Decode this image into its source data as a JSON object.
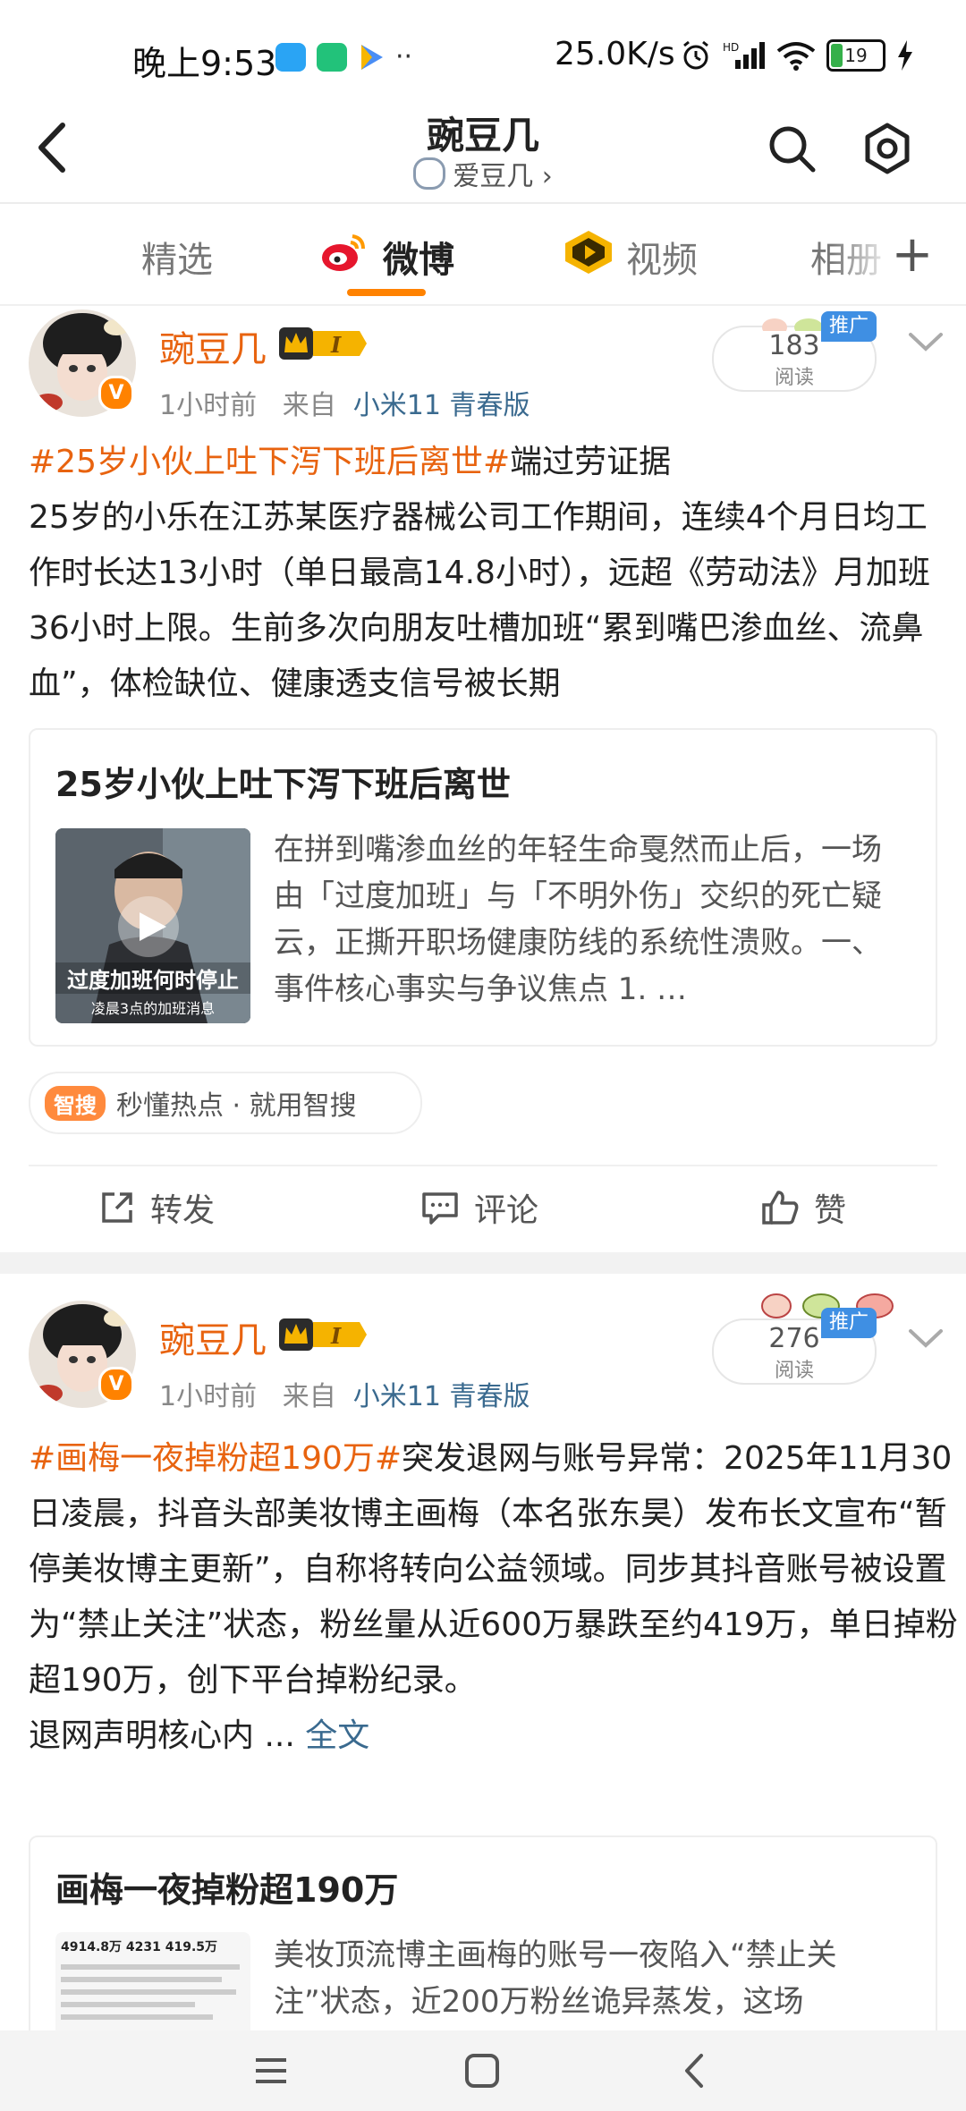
{
  "status_bar": {
    "time": "晚上9:53",
    "more": "··",
    "speed": "25.0K/s",
    "battery": "19"
  },
  "header": {
    "title": "豌豆几",
    "subtitle": "爱豆几 ›"
  },
  "tabs": [
    {
      "label": "精选"
    },
    {
      "label": "微博"
    },
    {
      "label": "视频"
    },
    {
      "label": "相册"
    }
  ],
  "tab_plus": "+",
  "posts": [
    {
      "username": "豌豆几",
      "level": "I",
      "time": "1小时前",
      "from_label": "来自",
      "source": "小米11 青春版",
      "reads": "183",
      "reads_label": "阅读",
      "promo": "推广",
      "hashtag": "#25岁小伙上吐下泻下班后离世#",
      "text_after_tag": "端过劳证据",
      "text": "25岁的小乐在江苏某医疗器械公司工作期间，连续4个月日均工作时长达13小时（单日最高14.8小时），远超《劳动法》月加班36小时上限。生前多次向朋友吐槽加班“累到嘴巴渗血丝、流鼻血”，体检缺位、健康透支信号被长期",
      "card": {
        "title": "25岁小伙上吐下泻下班后离世",
        "thumb_caption": "过度加班何时停止",
        "thumb_sub": "凌晨3点的加班消息",
        "summary": "在拼到嘴渗血丝的年轻生命戛然而止后，一场由「过度加班」与「不明外伤」交织的死亡疑云，正撕开职场健康防线的系统性溃败。一、事件核心事实与争议焦点  1. …"
      },
      "smart_badge": "智搜",
      "smart_text": "秒懂热点 · 就用智搜",
      "actions": {
        "repost": "转发",
        "comment": "评论",
        "like": "赞"
      }
    },
    {
      "username": "豌豆几",
      "level": "I",
      "time": "1小时前",
      "from_label": "来自",
      "source": "小米11 青春版",
      "reads": "276",
      "reads_label": "阅读",
      "promo": "推广",
      "hashtag": "#画梅一夜掉粉超190万#",
      "text_after_tag": "突发退网与账号异常：2025年11月30日凌晨，抖音头部美妆博主画梅（本名张东昊）发布长文宣布“暂停美妆博主更新”，自称将转向公益领域。同步其抖音账号被设置为“禁止关注”状态，粉丝量从近600万暴跌至约419万，单日掉粉超190万，创下平台掉粉纪录。",
      "text_line_last": "退网声明核心内",
      "ellipsis": " ... ",
      "full_text": "全文",
      "card": {
        "title": "画梅一夜掉粉超190万",
        "thumb_stats": "4914.8万  4231  419.5万",
        "summary": "美妆顶流博主画梅的账号一夜陷入“禁止关注”状态，近200万粉丝诡异蒸发，这场"
      }
    }
  ],
  "colors": {
    "accent": "#ff8200",
    "username": "#e8630f",
    "link": "#3a6a8f",
    "promo": "#3f8fe3"
  }
}
